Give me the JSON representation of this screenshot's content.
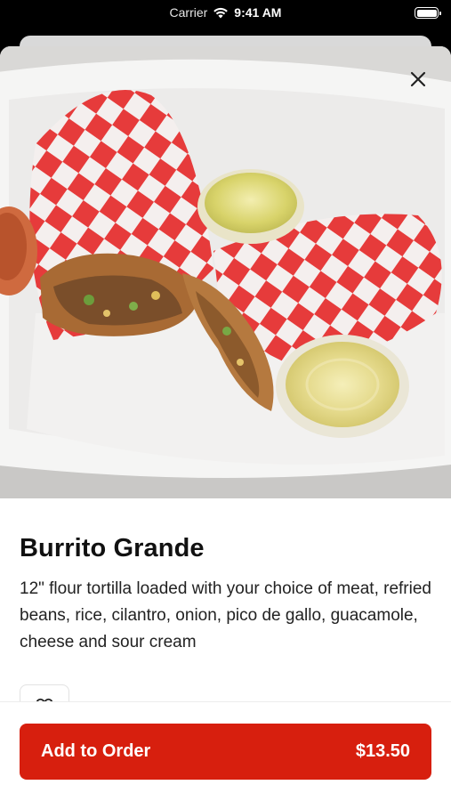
{
  "status_bar": {
    "carrier": "Carrier",
    "time": "9:41 AM",
    "icons": [
      "wifi-icon",
      "battery-icon"
    ]
  },
  "item": {
    "image_alt": "Burrito Grande photo",
    "title": "Burrito Grande",
    "description": "12\" flour tortilla loaded with your choice of meat, refried beans, rice, cilantro, onion, pico de gallo, guacamole, cheese and sour cream",
    "close_icon": "close-icon",
    "favorite_icon": "heart-icon"
  },
  "order": {
    "label": "Add to Order",
    "price": "$13.50"
  },
  "colors": {
    "accent": "#d71f0e",
    "text": "#111111"
  }
}
